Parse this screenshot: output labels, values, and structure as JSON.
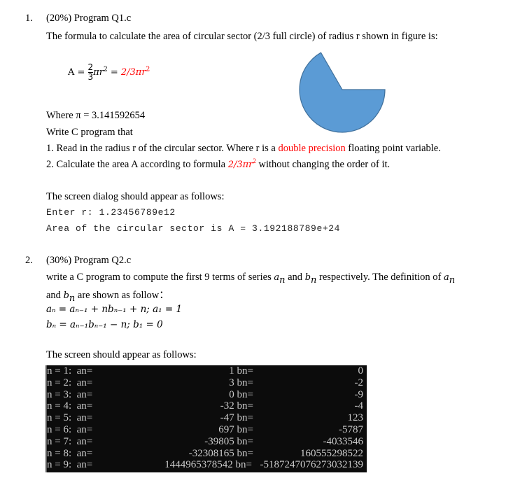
{
  "q1": {
    "number": "1.",
    "title": "(20%) Program Q1.c",
    "intro": "The formula to calculate the area of circular sector (2/3 full circle) of radius r shown in figure is:",
    "formula": {
      "lhs": "A = ",
      "frac_num": "2",
      "frac_den": "3",
      "middle": "πr",
      "middle_exp": "2",
      "eq": " = ",
      "red_part": "2/3πr",
      "red_exp": "2"
    },
    "figure": {
      "kind": "circular-sector",
      "fraction_of_circle": "2/3",
      "fill_color": "#5b9bd5",
      "stroke_color": "#41719c"
    },
    "pi_line": "Where π = 3.141592654",
    "write_line": "Write C program that",
    "step1_before": "1. Read in the radius r of the circular sector. Where r is a ",
    "step1_red": "double precision",
    "step1_after": " floating point variable.",
    "step2_before": "2. Calculate the area A according to formula ",
    "step2_formula": "2/3πr",
    "step2_exp": "2",
    "step2_after": " without changing the order of it.",
    "dialog_intro": "The screen dialog should appear as follows:",
    "dialog_line1": "Enter r: 1.23456789e12",
    "dialog_line2": "Area of the circular sector is A = 3.192188789e+24"
  },
  "q2": {
    "number": "2.",
    "title": "(30%) Program Q2.c",
    "intro_before": "write a C program to compute the first 9 terms of series ",
    "series_a": "a",
    "series_sub": "n",
    "and_word": " and ",
    "series_b": "b",
    "intro_after": " respectively. The definition of ",
    "line2_and": "and ",
    "line2_after": " are shown as follow：",
    "eq_a": "aₙ = aₙ₋₁ + nbₙ₋₁ + n;  a₁ = 1",
    "eq_b": "bₙ = aₙ₋₁bₙ₋₁ − n;  b₁ = 0",
    "screen_intro": "The screen should appear as follows:",
    "console": {
      "background": "#0c0c0c",
      "text_color": "#cccccc",
      "rows": [
        {
          "label": "n = 1:  an=",
          "an": "1",
          "bn_label": "bn=",
          "bn": "0"
        },
        {
          "label": "n = 2:  an=",
          "an": "3",
          "bn_label": "bn=",
          "bn": "-2"
        },
        {
          "label": "n = 3:  an=",
          "an": "0",
          "bn_label": "bn=",
          "bn": "-9"
        },
        {
          "label": "n = 4:  an=",
          "an": "-32",
          "bn_label": "bn=",
          "bn": "-4"
        },
        {
          "label": "n = 5:  an=",
          "an": "-47",
          "bn_label": "bn=",
          "bn": "123"
        },
        {
          "label": "n = 6:  an=",
          "an": "697",
          "bn_label": "bn=",
          "bn": "-5787"
        },
        {
          "label": "n = 7:  an=",
          "an": "-39805",
          "bn_label": "bn=",
          "bn": "-4033546"
        },
        {
          "label": "n = 8:  an=",
          "an": "-32308165",
          "bn_label": "bn=",
          "bn": "160555298522"
        },
        {
          "label": "n = 9:  an=",
          "an": "1444965378542",
          "bn_label": "bn=",
          "bn": "-5187247076273032139"
        }
      ]
    }
  }
}
